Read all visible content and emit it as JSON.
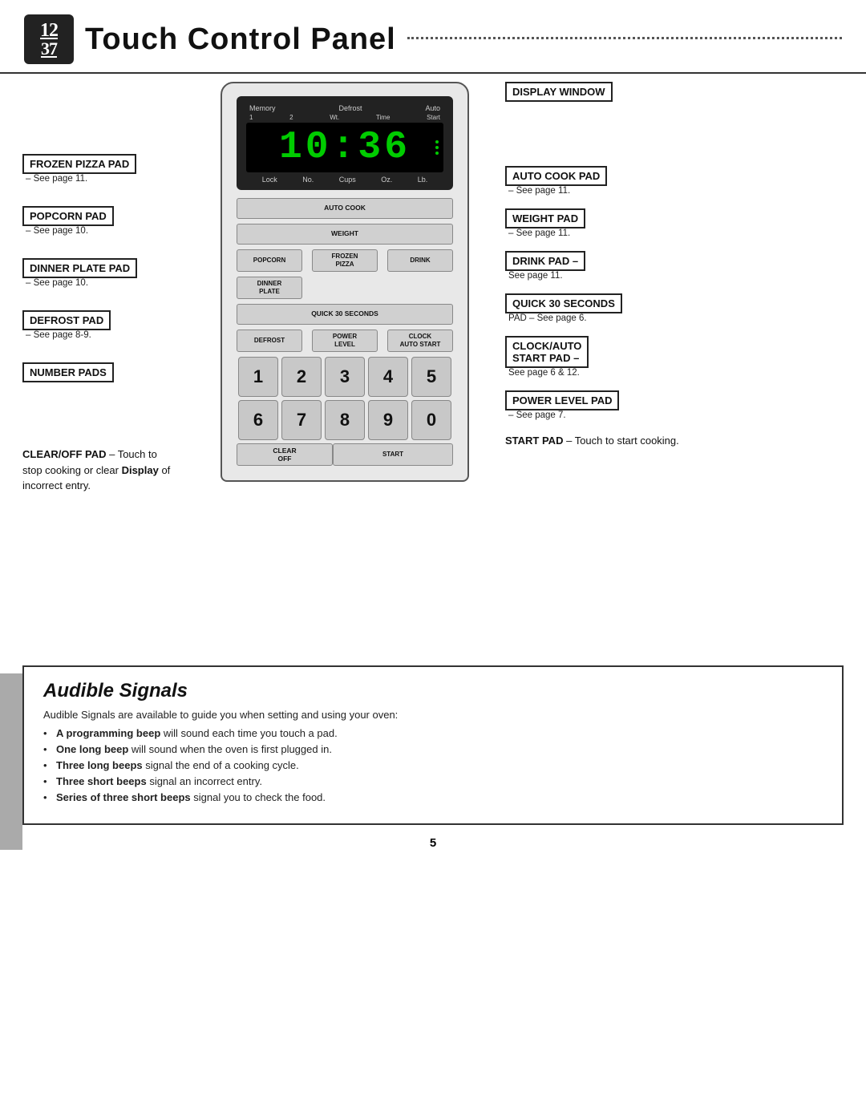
{
  "header": {
    "icon_text": "1̲2̲\n3̲7̲",
    "title": "Touch Control Panel"
  },
  "display": {
    "time": "10:36",
    "labels_top": [
      "Memory",
      "Defrost",
      "Auto"
    ],
    "labels_top2": [
      "1",
      "2",
      "Wt.",
      "Time",
      "Start"
    ],
    "labels_bottom": [
      "Lock",
      "No.",
      "Cups",
      "Oz.",
      "Lb."
    ]
  },
  "microwave_buttons": {
    "auto_cook": "AUTO COOK",
    "weight": "WEIGHT",
    "popcorn": "POPCORN",
    "frozen_pizza": "FROZEN\nPIZZA",
    "drink": "DRINK",
    "dinner_plate": "DINNER\nPLATE",
    "quick_30": "QUICK\n30 SECONDS",
    "defrost": "DEFROST",
    "power_level": "POWER\nLEVEL",
    "clock_auto_start": "CLOCK\nAUTO START",
    "clear_off": "CLEAR\nOFF",
    "start": "START",
    "numbers": [
      "1",
      "2",
      "3",
      "4",
      "5",
      "6",
      "7",
      "8",
      "9",
      "0"
    ]
  },
  "left_labels": [
    {
      "id": "frozen-pizza",
      "title": "FROZEN PIZZA PAD",
      "sub": "– See page 11."
    },
    {
      "id": "popcorn",
      "title": "POPCORN PAD",
      "sub": "– See page 10."
    },
    {
      "id": "dinner-plate",
      "title": "DINNER PLATE PAD",
      "sub": "– See page 10."
    },
    {
      "id": "defrost",
      "title": "DEFROST PAD",
      "sub": "– See page 8-9."
    },
    {
      "id": "number-pads",
      "title": "NUMBER PADS",
      "sub": ""
    },
    {
      "id": "clear-off",
      "title": "CLEAR/OFF PAD",
      "title_suffix": " – Touch",
      "sub": "to stop cooking or clear",
      "sub2": "Display of incorrect entry.",
      "bold_word": "Display"
    }
  ],
  "right_labels": [
    {
      "id": "display-window",
      "title": "DISPLAY WINDOW",
      "sub": ""
    },
    {
      "id": "auto-cook",
      "title": "AUTO COOK PAD",
      "sub": "– See page 11."
    },
    {
      "id": "weight",
      "title": "WEIGHT PAD",
      "sub": "– See page 11."
    },
    {
      "id": "drink",
      "title": "DRINK PAD –",
      "sub": "See page 11."
    },
    {
      "id": "quick30",
      "title": "QUICK 30 SECONDS",
      "sub": "PAD – See page 6."
    },
    {
      "id": "clock-auto",
      "title": "CLOCK/AUTO",
      "title2": "START PAD –",
      "sub": "See page 6 & 12."
    },
    {
      "id": "power-level",
      "title": "POWER LEVEL PAD",
      "sub": "– See page 7."
    },
    {
      "id": "start",
      "title": "START PAD",
      "title_suffix": " – Touch",
      "sub": "to start cooking."
    }
  ],
  "audible": {
    "title": "Audible Signals",
    "intro": "Audible Signals are available to guide you when setting and using your oven:",
    "items": [
      {
        "bold": "A programming beep",
        "rest": " will sound each time you touch a pad."
      },
      {
        "bold": "One long beep",
        "rest": " will sound when the oven is first plugged in."
      },
      {
        "bold": "Three long beeps",
        "rest": " signal the end of a cooking cycle."
      },
      {
        "bold": "Three short beeps",
        "rest": " signal an incorrect entry."
      },
      {
        "bold": "Series of three short beeps",
        "rest": " signal you to check the food."
      }
    ]
  },
  "page_number": "5"
}
